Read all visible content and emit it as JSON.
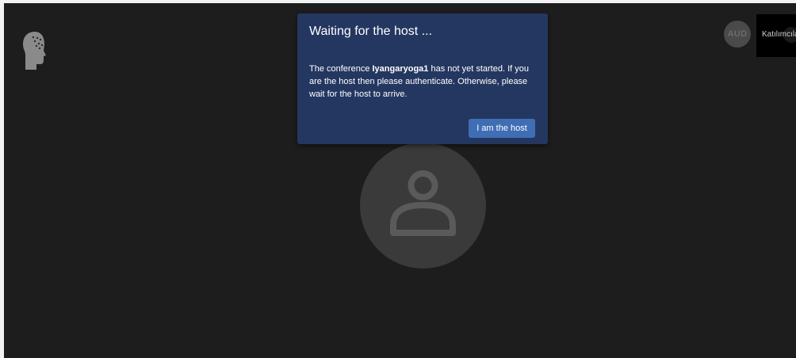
{
  "dialog": {
    "title": "Waiting for the host ...",
    "body_prefix": "The conference ",
    "conference_name": "Iyangaryoga1",
    "body_suffix": " has not yet started. If you are the host then please authenticate. Otherwise, please wait for the host to arrive.",
    "host_button_label": "I am the host"
  },
  "toolbar": {
    "audio_badge": "AUD",
    "participants_label": "Katılımcılar"
  },
  "icons": {
    "logo": "jitsi-head-logo-icon",
    "avatar": "user-avatar-icon"
  },
  "colors": {
    "background": "#1d1d1d",
    "dialog_background": "#243760",
    "button_accent": "#3f6eb5"
  }
}
